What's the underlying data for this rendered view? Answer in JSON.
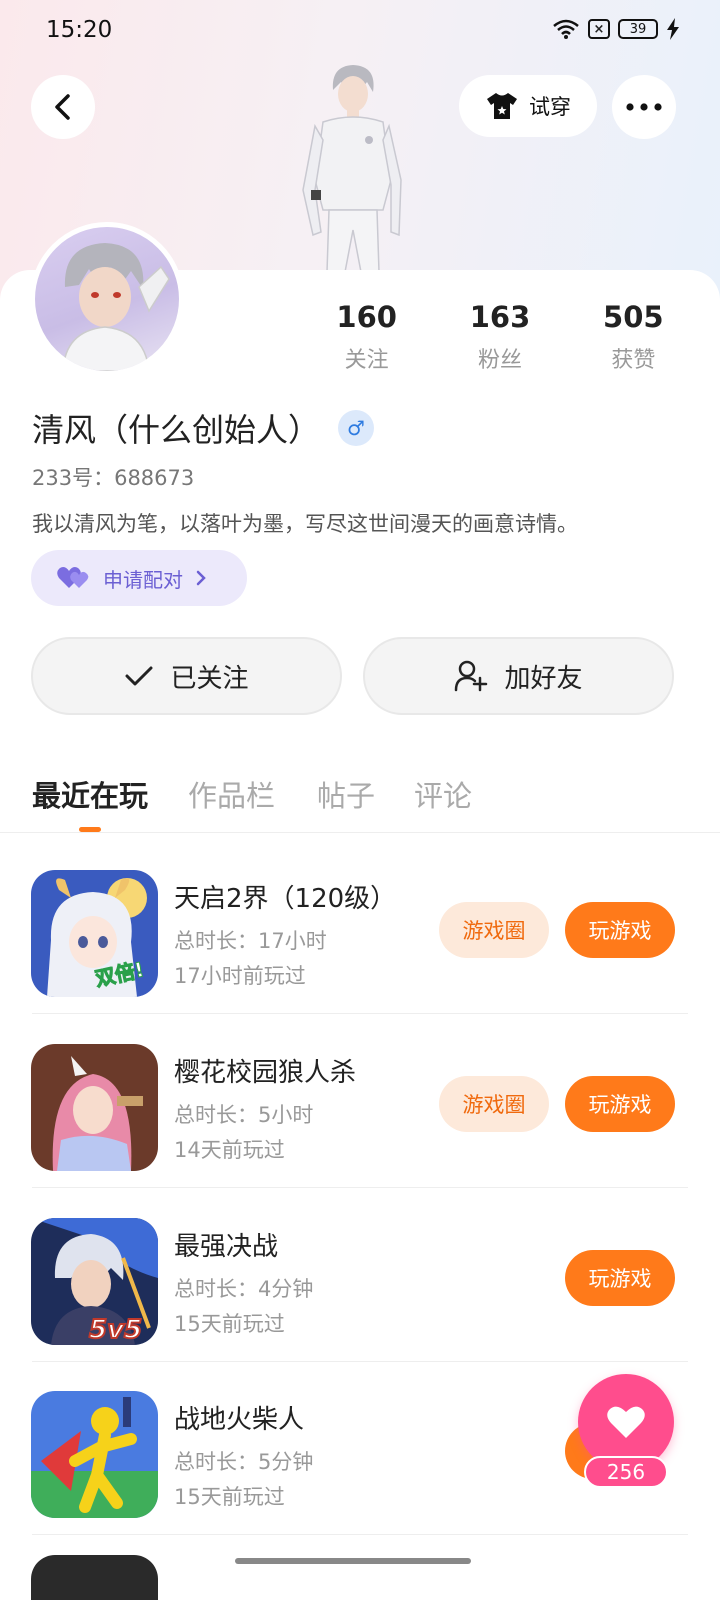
{
  "status_bar": {
    "time": "15:20",
    "battery": "39"
  },
  "header": {
    "try_on_label": "试穿"
  },
  "profile": {
    "stats": [
      {
        "value": "160",
        "label": "关注"
      },
      {
        "value": "163",
        "label": "粉丝"
      },
      {
        "value": "505",
        "label": "获赞"
      }
    ],
    "name": "清风（什么创始人）",
    "gender_symbol": "♂",
    "id_text": "233号：688673",
    "bio": "我以清风为笔，以落叶为墨，写尽这世间漫天的画意诗情。",
    "pair_label": "申请配对"
  },
  "actions": {
    "follow_label": "已关注",
    "add_friend_label": "加好友"
  },
  "tabs": [
    "最近在玩",
    "作品栏",
    "帖子",
    "评论"
  ],
  "games": [
    {
      "title": "天启2界（120级）",
      "total_time": "总时长：17小时",
      "last_played": "17小时前玩过",
      "circle_label": "游戏圈",
      "play_label": "玩游戏",
      "icon": "anime-girl-icon",
      "badge": "双倍!"
    },
    {
      "title": "樱花校园狼人杀",
      "total_time": "总时长：5小时",
      "last_played": "14天前玩过",
      "circle_label": "游戏圈",
      "play_label": "玩游戏",
      "icon": "pink-hair-girl-icon"
    },
    {
      "title": "最强决战",
      "total_time": "总时长：4分钟",
      "last_played": "15天前玩过",
      "play_label": "玩游戏",
      "icon": "warrior-icon",
      "badge": "5v5"
    },
    {
      "title": "战地火柴人",
      "total_time": "总时长：5分钟",
      "last_played": "15天前玩过",
      "icon": "stickman-icon"
    }
  ],
  "like_fab": {
    "count": "256"
  },
  "colors": {
    "accent": "#ff7a1a",
    "pink": "#ff4d8d",
    "purple": "#6b5fd3"
  }
}
